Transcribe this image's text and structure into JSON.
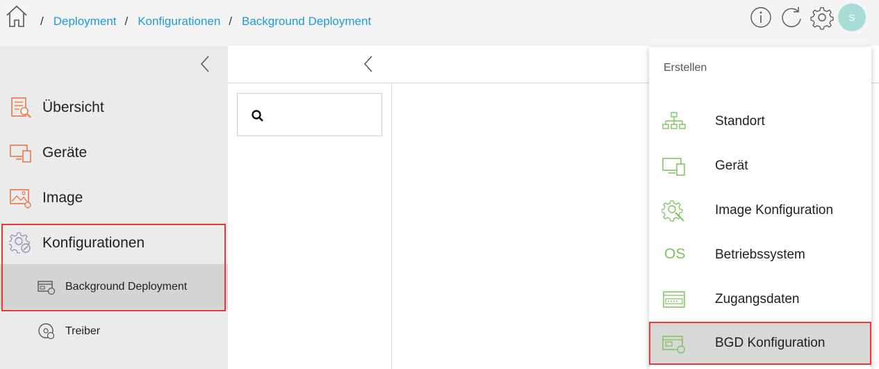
{
  "header": {
    "breadcrumbs": [
      "Deployment",
      "Konfigurationen",
      "Background Deployment"
    ],
    "avatar_initial": "S"
  },
  "sidebar": {
    "items": [
      {
        "label": "Übersicht",
        "icon": "overview-document-icon"
      },
      {
        "label": "Geräte",
        "icon": "devices-icon"
      },
      {
        "label": "Image",
        "icon": "image-icon"
      },
      {
        "label": "Konfigurationen",
        "icon": "configurations-gear-icon"
      }
    ],
    "subitems": [
      {
        "label": "Background Deployment",
        "icon": "background-deployment-icon",
        "active": true
      },
      {
        "label": "Treiber",
        "icon": "driver-disc-icon",
        "active": false
      }
    ]
  },
  "search": {
    "placeholder": "",
    "value": ""
  },
  "menu": {
    "header": "Erstellen",
    "items": [
      {
        "label": "Standort",
        "icon": "sitemap-icon"
      },
      {
        "label": "Gerät",
        "icon": "device-icon"
      },
      {
        "label": "Image Konfiguration",
        "icon": "image-config-icon"
      },
      {
        "label": "Betriebssystem",
        "icon": "os-icon",
        "icon_text": "OS"
      },
      {
        "label": "Zugangsdaten",
        "icon": "credentials-icon"
      },
      {
        "label": "BGD Konfiguration",
        "icon": "bgd-config-icon",
        "active": true
      }
    ]
  },
  "colors": {
    "accent": "#1e9bd7",
    "sidebar_icon": "#e87a4f",
    "menu_icon": "#7cc35a",
    "highlight": "#e53935"
  }
}
